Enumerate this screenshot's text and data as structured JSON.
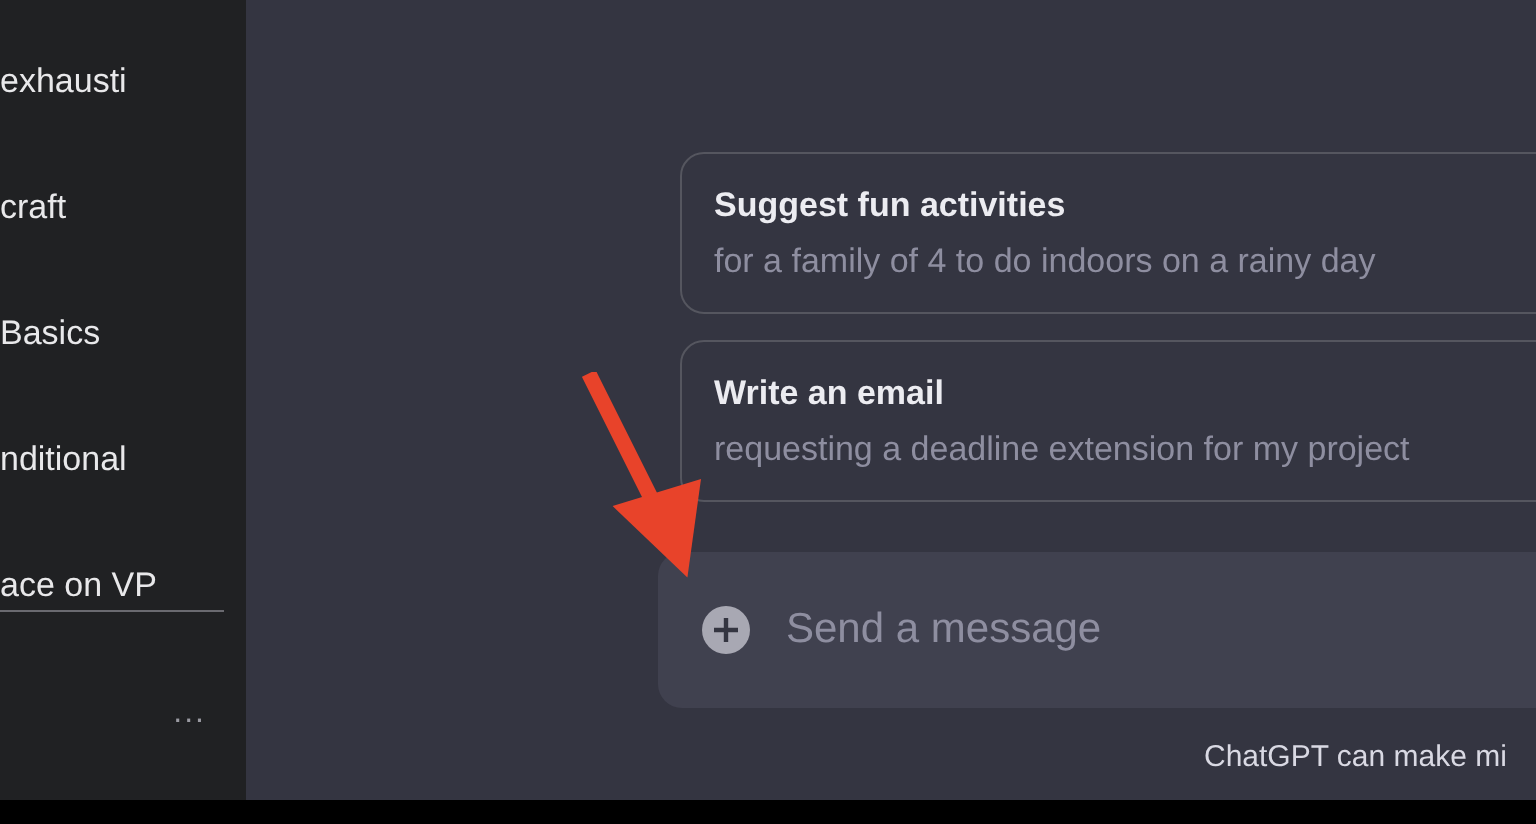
{
  "sidebar": {
    "items": [
      {
        "label": "exhausti"
      },
      {
        "label": "craft"
      },
      {
        "label": "Basics"
      },
      {
        "label": "nditional"
      },
      {
        "label": "ace on VP"
      }
    ],
    "more": "..."
  },
  "suggestions": [
    {
      "title": "Suggest fun activities",
      "subtitle": "for a family of 4 to do indoors on a rainy day"
    },
    {
      "title": "Write an email",
      "subtitle": "requesting a deadline extension for my project"
    }
  ],
  "composer": {
    "placeholder": "Send a message"
  },
  "footer_note": "ChatGPT can make mi"
}
